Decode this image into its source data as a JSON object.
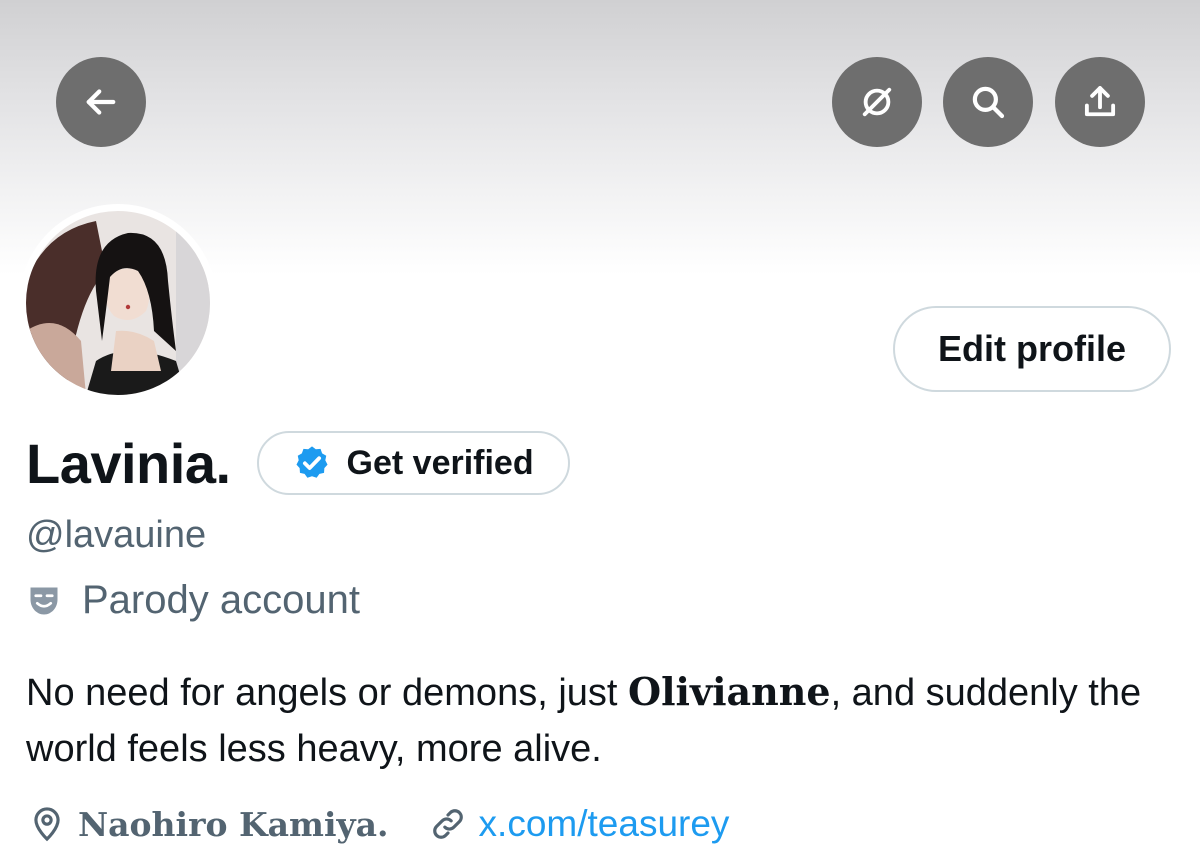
{
  "header": {
    "back_icon": "arrow-left-icon",
    "grok_icon": "grok-icon",
    "search_icon": "search-icon",
    "share_icon": "share-upload-icon"
  },
  "profile": {
    "display_name": "Lavinia.",
    "get_verified_label": "Get verified",
    "handle": "@lavauine",
    "parody_label": "Parody account",
    "edit_profile_label": "Edit profile",
    "bio_part1": "No need for angels or demons, just ",
    "bio_bold": "Olivianne",
    "bio_part2": ", and suddenly the world feels less heavy, more alive.",
    "location": "Naohiro Kamiya.",
    "website": "x.com/teasurey"
  },
  "colors": {
    "accent": "#1d9bf0",
    "secondary_text": "#536471",
    "primary_text": "#0f1419",
    "border": "#cfd9de",
    "icon_button_bg": "#6e6e6e"
  }
}
